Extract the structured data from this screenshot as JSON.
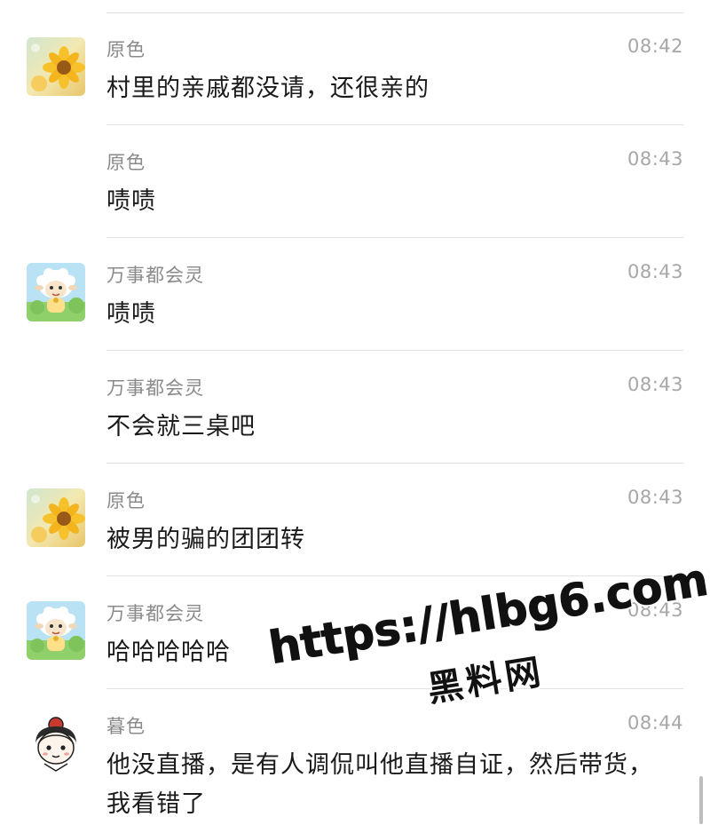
{
  "messages": [
    {
      "sender": "原色",
      "time": "08:42",
      "text": "村里的亲戚都没请，还很亲的",
      "avatar": "sunflower-avatar"
    },
    {
      "sender": "原色",
      "time": "08:43",
      "text": "啧啧",
      "avatar": null
    },
    {
      "sender": "万事都会灵",
      "time": "08:43",
      "text": "啧啧",
      "avatar": "sheep-avatar"
    },
    {
      "sender": "万事都会灵",
      "time": "08:43",
      "text": "不会就三桌吧",
      "avatar": null
    },
    {
      "sender": "原色",
      "time": "08:43",
      "text": "被男的骗的团团转",
      "avatar": "sunflower-avatar"
    },
    {
      "sender": "万事都会灵",
      "time": "08:43",
      "text": "哈哈哈哈哈",
      "avatar": "sheep-avatar"
    },
    {
      "sender": "暮色",
      "time": "08:44",
      "text": "他没直播，是有人调侃叫他直播自证，然后带货，我看错了",
      "avatar": "cartoon-girl-avatar"
    }
  ],
  "watermark": {
    "url": "https://hlbg6.com",
    "name": "黑料网"
  },
  "colors": {
    "divider": "#e3e3e3",
    "sender": "#8a8a8a",
    "time": "#a7a7a7",
    "text": "#1a1a1a"
  }
}
